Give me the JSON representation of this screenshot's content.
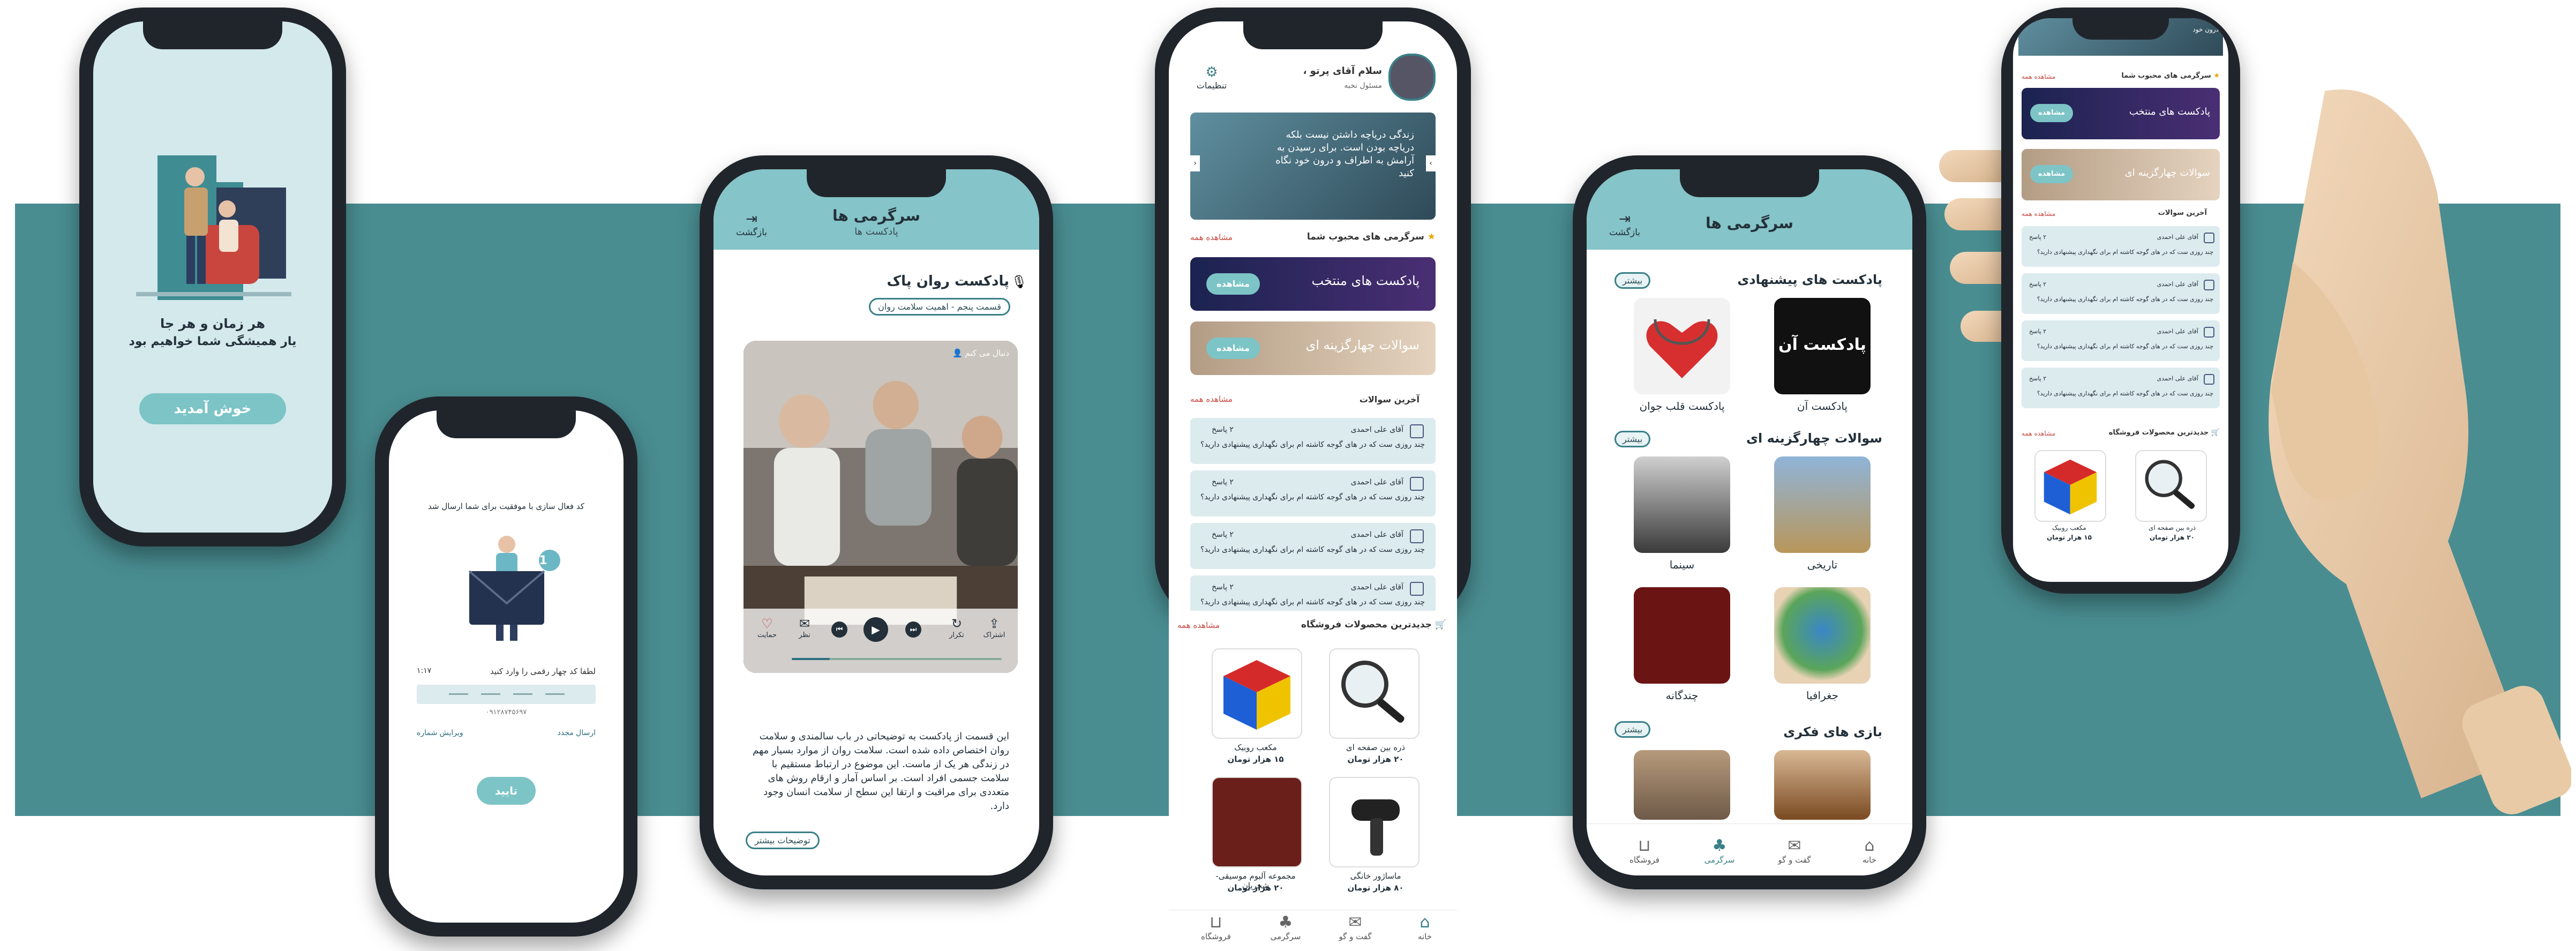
{
  "colors": {
    "band": "#498d91",
    "header": "#85c4c8",
    "accent": "#7cc4c6",
    "dark": "#20252c"
  },
  "splash": {
    "line1": "هر زمان و هر جا",
    "line2": "یار همیشگی شما خواهیم بود",
    "welcome_button": "خوش آمدید"
  },
  "verify": {
    "sent_message": "کد فعال سازی با موفقیت برای شما ارسال شد",
    "badge": "1",
    "enter_code_label": "لطفا کد چهار رقمی را وارد کنید",
    "timer": "۱:۱۷",
    "phone_number": "۰۹۱۲۸۷۴۵۶۹۷",
    "resend_label": "ارسال مجدد",
    "edit_number_label": "ویرایش شماره",
    "confirm_button": "تایید"
  },
  "podcast": {
    "header_title": "سرگرمی ها",
    "header_subtitle": "پادکست ها",
    "back_label": "بازگشت",
    "title": "پادکست روان پاک",
    "episode": "قسمت پنجم - اهمیت سلامت روان",
    "follow_label": "دنبال می کنم",
    "controls": [
      "اشتراک",
      "تکرار",
      "نظر",
      "حمایت"
    ],
    "description": "این قسمت از پادکست به توضیحاتی در باب سالمندی و سلامت روان اختصاص داده شده است. سلامت روان از موارد بسیار مهم در زندگی هر یک از ماست. این موضوع در ارتباط مستقیم با سلامت جسمی افراد است. بر اساس آمار و ارقام روش های متعددی برای مراقبت و ارتقا این سطح از سلامت انسان وجود دارد.",
    "more_button": "توضیحات بیشتر"
  },
  "home": {
    "greeting": "سلام آقای پرتو ،",
    "user_subtitle": "مسئول نخبه",
    "settings_label": "تنظیمات",
    "banner_text": "زندگی دریاچه داشتن نیست بلکه دریاچه بودن است. برای رسیدن به آرامش به اطراف و درون خود نگاه کنید",
    "favorites_title": "سرگرمی های محبوب شما",
    "see_all": "مشاهده همه",
    "featured_podcasts": "پادکست های منتخب",
    "multiple_choice": "سوالات چهارگزینه ای",
    "view_button": "مشاهده",
    "latest_questions_title": "آخرین سوالات",
    "questions": [
      {
        "author": "آقای علی احمدی",
        "text": "چند روزی ست که در های گوجه کاشته ام برای نگهداری پیشنهادی دارید؟",
        "answers": "۲ پاسخ"
      },
      {
        "author": "آقای علی احمدی",
        "text": "چند روزی ست که در های گوجه کاشته ام برای نگهداری پیشنهادی دارید؟",
        "answers": "۲ پاسخ"
      },
      {
        "author": "آقای علی احمدی",
        "text": "چند روزی ست که در های گوجه کاشته ام برای نگهداری پیشنهادی دارید؟",
        "answers": "۲ پاسخ"
      },
      {
        "author": "آقای علی احمدی",
        "text": "چند روزی ست که در های گوجه کاشته ام برای نگهداری پیشنهادی دارید؟",
        "answers": "۲ پاسخ"
      }
    ],
    "store_title": "جدیدترین محصولات فروشگاه",
    "products": [
      {
        "name": "ذره بین صفحه ای",
        "price": "۲۰ هزار تومان"
      },
      {
        "name": "مکعب روبیک",
        "price": "۱۵ هزار تومان"
      },
      {
        "name": "ماساژور خانگی",
        "price": "۸۰ هزار تومان"
      },
      {
        "name": "مجموعه آلبوم موسیقی- شجریان",
        "price": "۲۰ هزار تومان"
      }
    ],
    "nav": [
      "خانه",
      "گفت و گو",
      "سرگرمی",
      "فروشگاه"
    ]
  },
  "entertainment": {
    "header_title": "سرگرمی ها",
    "back_label": "بازگشت",
    "more_label": "بیشتر",
    "section_podcasts": "پادکست های پیشنهادی",
    "podcasts": [
      "پادکست آن",
      "پادکست قلب جوان"
    ],
    "podcast_logo_text": "پادکست آن",
    "section_quiz": "سوالات چهارگزینه ای",
    "quiz": [
      "تاریخی",
      "سینما",
      "جغرافیا",
      "چندگانه"
    ],
    "section_games": "بازی های فکری",
    "nav": [
      "خانه",
      "گفت و گو",
      "سرگرمی",
      "فروشگاه"
    ]
  },
  "hand_phone": {
    "top_text": "درون خود",
    "favorites_title": "سرگرمی های محبوب شما",
    "see_all": "مشاهده همه",
    "featured_podcasts": "پادکست های منتخب",
    "multiple_choice": "سوالات چهارگزینه ای",
    "view_button": "مشاهده",
    "latest_questions_title": "آخرین سوالات",
    "question_author": "آقای علی احمدی",
    "question_text": "چند روزی ست که در های گوجه کاشته ام برای نگهداری پیشنهادی دارید؟",
    "question_answers": "۲ پاسخ",
    "store_title": "جدیدترین محصولات فروشگاه",
    "products": [
      {
        "name": "ذره بین صفحه ای",
        "price": "۲۰ هزار تومان"
      },
      {
        "name": "مکعب روبیک",
        "price": "۱۵ هزار تومان"
      }
    ]
  }
}
